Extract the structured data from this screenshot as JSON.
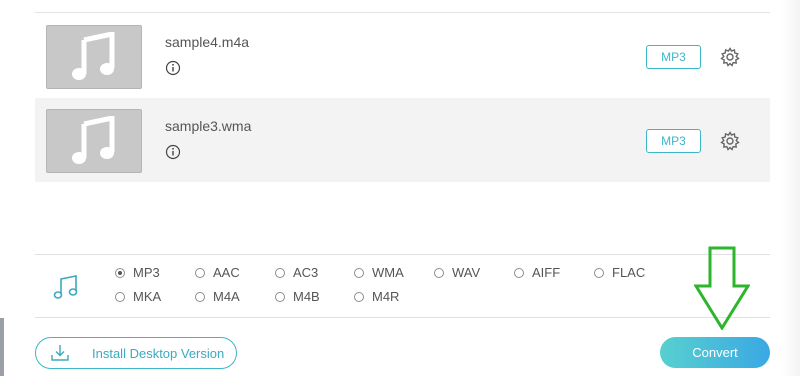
{
  "files": [
    {
      "name": "sample4.m4a",
      "format": "MP3",
      "thumb_icon": "music-note-icon",
      "info_icon": "info-icon",
      "settings_icon": "gear-icon"
    },
    {
      "name": "sample3.wma",
      "format": "MP3",
      "thumb_icon": "music-note-icon",
      "info_icon": "info-icon",
      "settings_icon": "gear-icon"
    }
  ],
  "format_panel": {
    "icon": "music-note-icon",
    "selected": "MP3",
    "options": [
      "MP3",
      "AAC",
      "AC3",
      "WMA",
      "WAV",
      "AIFF",
      "FLAC",
      "MKA",
      "M4A",
      "M4B",
      "M4R"
    ]
  },
  "install_button": {
    "label": "Install Desktop Version",
    "icon": "download-icon"
  },
  "convert_button": {
    "label": "Convert"
  },
  "annotation": {
    "icon": "green-down-arrow"
  },
  "colors": {
    "accent": "#3cb6c9",
    "convert_gradient_start": "#57d0cf",
    "convert_gradient_end": "#3aa8e4",
    "arrow": "#2db52d"
  }
}
